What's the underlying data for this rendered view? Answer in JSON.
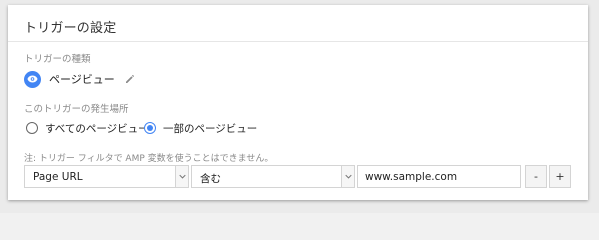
{
  "card": {
    "title": "トリガーの設定"
  },
  "trigger_type": {
    "section_label": "トリガーの種類",
    "icon": "eye-icon",
    "label": "ページビュー",
    "edit_icon": "pencil-icon"
  },
  "trigger_fires": {
    "section_label": "このトリガーの発生場所",
    "options": [
      {
        "label": "すべてのページビュー",
        "checked": false
      },
      {
        "label": "一部のページビュー",
        "checked": true
      }
    ]
  },
  "condition": {
    "note": "注: トリガー フィルタで AMP 変数を使うことはできません。",
    "variable": "Page URL",
    "operator": "含む",
    "value": "www.sample.com",
    "remove_label": "-",
    "add_label": "+"
  },
  "colors": {
    "accent": "#4285f4",
    "border": "#d4d4d4",
    "muted_text": "#8a8a8a"
  }
}
